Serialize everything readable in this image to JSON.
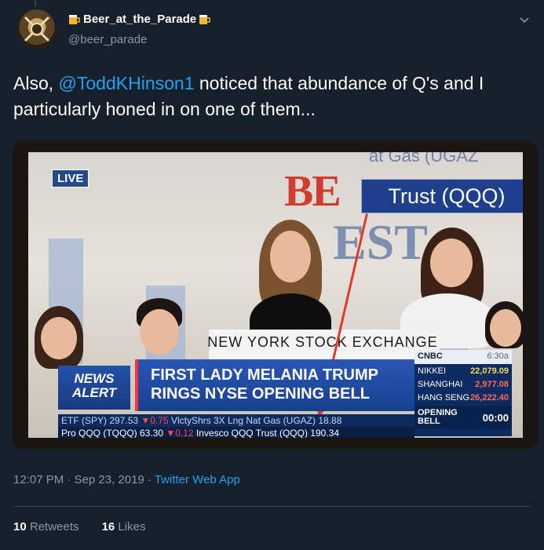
{
  "tweet": {
    "display_name": "Beer_at_the_Parade",
    "handle": "@beer_parade",
    "text_prefix": "Also, ",
    "mention": "@ToddKHinson1",
    "text_suffix": " noticed that abundance of Q's and I particularly honed in on one of them...",
    "timestamp": "12:07 PM · Sep 23, 2019",
    "separator": " · ",
    "app": "Twitter Web App",
    "retweets_count": "10",
    "retweets_label": " Retweets",
    "likes_count": "16",
    "likes_label": " Likes"
  },
  "media": {
    "live_badge": "LIVE",
    "backdrop_letters_be": "BE",
    "backdrop_letters_est": "EST",
    "gas_fragment": "at Gas (UGAZ",
    "trust_banner": "Trust (QQQ)",
    "podium_text": "NEW YORK STOCK EXCHANGE",
    "news_alert_line1": "NEWS",
    "news_alert_line2": "ALERT",
    "headline_line1": "FIRST LADY MELANIA TRUMP",
    "headline_line2": "RINGS NYSE OPENING BELL",
    "cnbc": {
      "logo": "CNBC",
      "time": "6:30a",
      "rows": [
        {
          "label": "NIKKEI",
          "value": "22,079.09",
          "color": "#ffd84b"
        },
        {
          "label": "SHANGHAI",
          "value": "2,977.08",
          "color": "#ff6a5a"
        },
        {
          "label": "HANG SENG",
          "value": "26,222.40",
          "color": "#ff6a5a"
        }
      ],
      "opening_label1": "OPENING",
      "opening_label2": "BELL",
      "opening_time": "00:00"
    },
    "ticker_line1_a": "ETF (SPY) 297.53 ",
    "ticker_line1_down": "▼0.75",
    "ticker_line1_b": "   VlctyShrs 3X Lng Nat Gas (UGAZ) 18.88",
    "ticker_line2_a": "Pro QQQ (TQQQ) 63.30 ",
    "ticker_line2_down": "▼0.12",
    "ticker_line2_b": "  Invesco QQQ Trust (QQQ) 190.34"
  },
  "colors": {
    "background": "#15202b",
    "link": "#1da1f2",
    "muted": "#8899a6"
  }
}
